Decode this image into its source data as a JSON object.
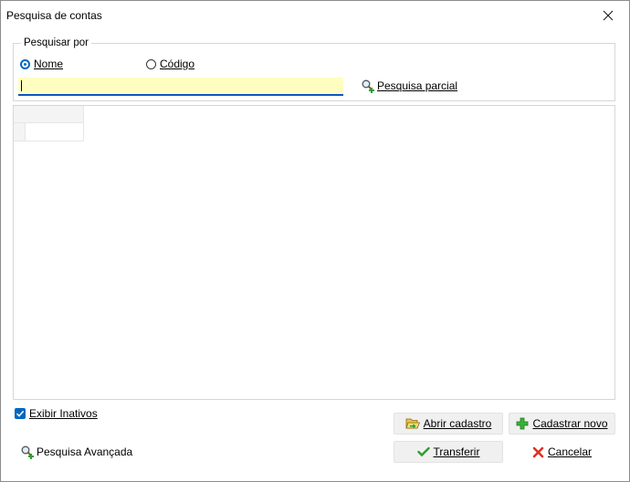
{
  "window": {
    "title": "Pesquisa de contas"
  },
  "search_by": {
    "legend": "Pesquisar por",
    "options": [
      {
        "label": "Nome",
        "selected": true
      },
      {
        "label": "Código",
        "selected": false
      }
    ],
    "input_value": "",
    "partial_search_label": "Pesquisa parcial"
  },
  "show_inactive": {
    "label": "Exibir Inativos",
    "checked": true
  },
  "buttons": {
    "open_record": "Abrir cadastro",
    "register_new": "Cadastrar novo",
    "transfer": "Transferir",
    "cancel": "Cancelar",
    "advanced_search": "Pesquisa Avançada"
  },
  "colors": {
    "accent": "#0067c0",
    "input_bg": "#fffec0",
    "green": "#2e9e2e",
    "red": "#e03020"
  }
}
